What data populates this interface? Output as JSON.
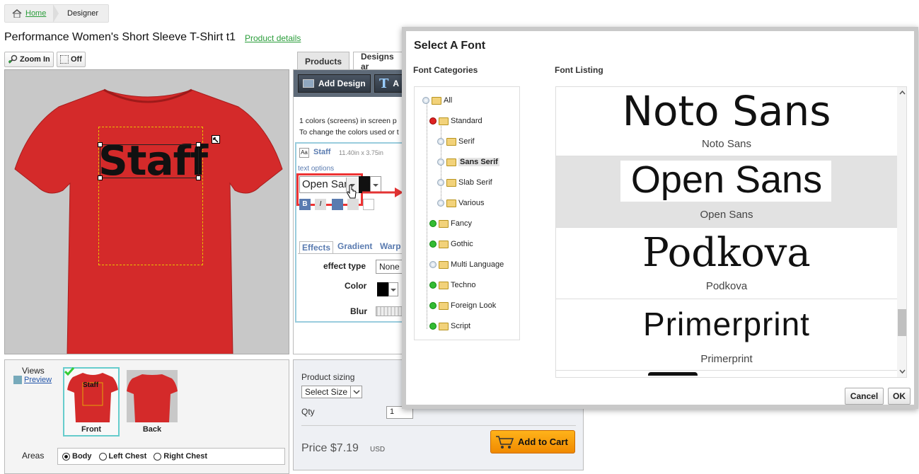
{
  "breadcrumb": {
    "home": "Home",
    "current": "Designer"
  },
  "product": {
    "title": "Performance Women's Short Sleeve T-Shirt t1",
    "details_link": "Product details"
  },
  "canvas_toolbar": {
    "zoom_in": "Zoom In",
    "off": "Off"
  },
  "design": {
    "text": "Staff"
  },
  "tabs": {
    "products": "Products",
    "designs": "Designs ar"
  },
  "design_toolbar": {
    "add_design": "Add Design",
    "add_text": "A"
  },
  "info": {
    "line1": "1 colors (screens) in screen p",
    "line2": "To change the colors used or t"
  },
  "text_item": {
    "name": "Staff",
    "size": "11.40in x 3.75in",
    "options_label": "text options",
    "font_value": "Open San"
  },
  "effects": {
    "tabs": [
      "Effects",
      "Gradient",
      "Warp"
    ],
    "effect_type_label": "effect type",
    "effect_type_value": "None",
    "color_label": "Color",
    "blur_label": "Blur"
  },
  "views": {
    "label": "Views",
    "preview": "Preview",
    "items": [
      {
        "name": "Front",
        "mini_text": "Staff"
      },
      {
        "name": "Back"
      }
    ],
    "areas_label": "Areas",
    "areas": [
      "Body",
      "Left Chest",
      "Right Chest"
    ]
  },
  "sizing": {
    "label": "Product sizing",
    "select_value": "Select Size",
    "qty_label": "Qty",
    "qty_value": "1",
    "price": "Price $7.19",
    "currency": "USD",
    "add_to_cart": "Add to Cart"
  },
  "modal": {
    "title": "Select A Font",
    "categories_title": "Font Categories",
    "listing_title": "Font Listing",
    "categories": [
      "All",
      "Standard",
      "Serif",
      "Sans Serif",
      "Slab Serif",
      "Various",
      "Fancy",
      "Gothic",
      "Multi Language",
      "Techno",
      "Foreign Look",
      "Script"
    ],
    "fonts": [
      {
        "sample": "Noto Sans",
        "name": "Noto Sans"
      },
      {
        "sample": "Open Sans",
        "name": "Open Sans"
      },
      {
        "sample": "Podkova",
        "name": "Podkova"
      },
      {
        "sample": "Primerprint",
        "name": "Primerprint"
      }
    ],
    "cancel": "Cancel",
    "ok": "OK"
  },
  "colors": {
    "shirt": "#d42a2a",
    "accent_green": "#2a9d3a",
    "highlight_red": "#e33333"
  }
}
